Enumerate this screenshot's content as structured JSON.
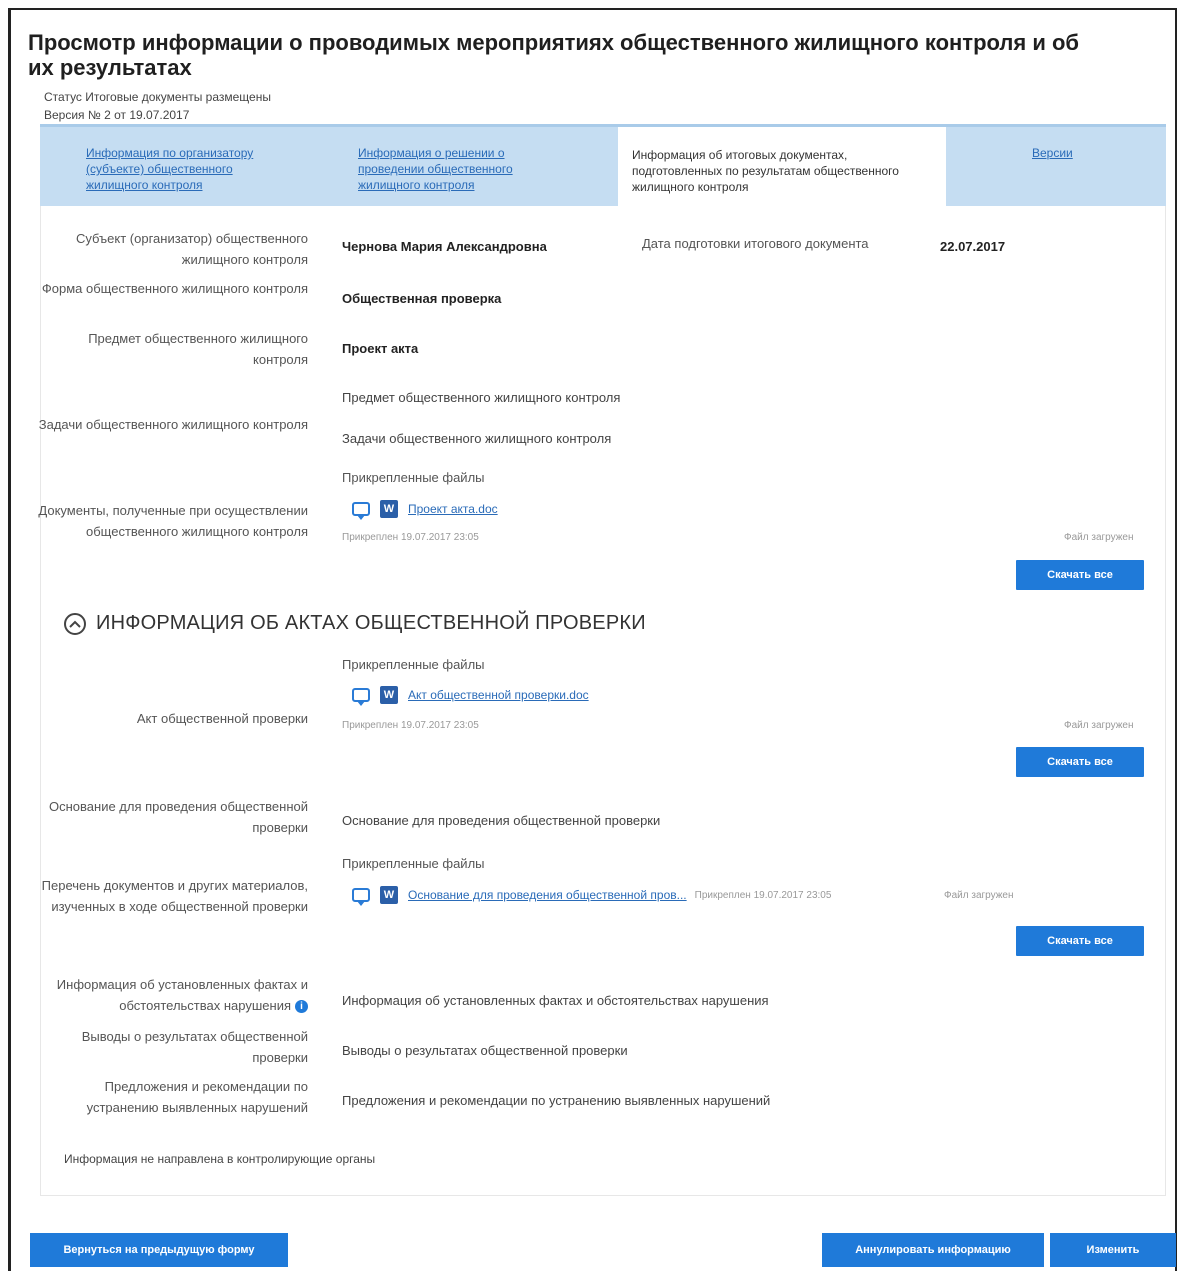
{
  "page": {
    "title": "Просмотр информации о проводимых мероприятиях общественного жилищного контроля и об их результатах",
    "status": "Статус Итоговые документы размещены",
    "version": "Версия № 2 от 19.07.2017"
  },
  "tabs": [
    {
      "label": "Информация по организатору (субъекте) общественного жилищного контроля"
    },
    {
      "label": "Информация о решении о проведении общественного жилищного контроля"
    },
    {
      "label": "Информация об итоговых документах, подготовленных по результатам общественного жилищного контроля"
    },
    {
      "label": "Версии"
    }
  ],
  "details": {
    "subject_label": "Субъект (организатор) общественного жилищного контроля",
    "subject_value": "Чернова Мария Александровна",
    "date_label": "Дата подготовки итогового документа",
    "date_value": "22.07.2017",
    "form_label": "Форма общественного жилищного контроля",
    "form_value": "Общественная проверка",
    "subject_matter_label": "Предмет общественного жилищного контроля",
    "subject_matter_value": "Проект акта",
    "subject_matter_text": "Предмет общественного жилищного контроля",
    "tasks_label": "Задачи общественного жилищного контроля",
    "tasks_value": "Задачи общественного жилищного контроля",
    "docs_label": "Документы, полученные при осуществлении общественного жилищного контроля",
    "attached_files_title": "Прикрепленные файлы",
    "docs_file": "Проект акта.doc",
    "docs_attached_meta": "Прикреплен 19.07.2017 23:05",
    "docs_file_status": "Файл загружен",
    "download_label": "Скачать все"
  },
  "acts_section": {
    "title": "ИНФОРМАЦИЯ ОБ АКТАХ ОБЩЕСТВЕННОЙ ПРОВЕРКИ",
    "act_label": "Акт общественной проверки",
    "attached_files_title": "Прикрепленные файлы",
    "act_file": "Акт общественной проверки.doc",
    "act_attached_meta": "Прикреплен 19.07.2017 23:05",
    "act_file_status": "Файл загружен",
    "download_label": "Скачать все",
    "basis_label": "Основание для проведения общественной проверки",
    "basis_value": "Основание для проведения общественной проверки",
    "materials_label": "Перечень документов и других материалов, изученных в ходе общественной проверки",
    "materials_attached_title": "Прикрепленные файлы",
    "materials_file": "Основание для проведения общественной пров...",
    "materials_attached_meta": "Прикреплен 19.07.2017 23:05",
    "materials_file_status": "Файл загружен",
    "materials_download_label": "Скачать все",
    "facts_label": "Информация об установленных фактах и обстоятельствах нарушения",
    "facts_value": "Информация об установленных фактах и обстоятельствах нарушения",
    "conclusions_label": "Выводы о результатах общественной проверки",
    "conclusions_value": "Выводы о результатах общественной проверки",
    "proposals_label": "Предложения и рекомендации по устранению выявленных нарушений",
    "proposals_value": "Предложения и рекомендации по устранению выявленных нарушений"
  },
  "footer_note": "Информация не направлена в контролирующие органы",
  "buttons": {
    "back": "Вернуться на предыдущую форму",
    "annul": "Аннулировать информацию",
    "edit": "Изменить"
  }
}
